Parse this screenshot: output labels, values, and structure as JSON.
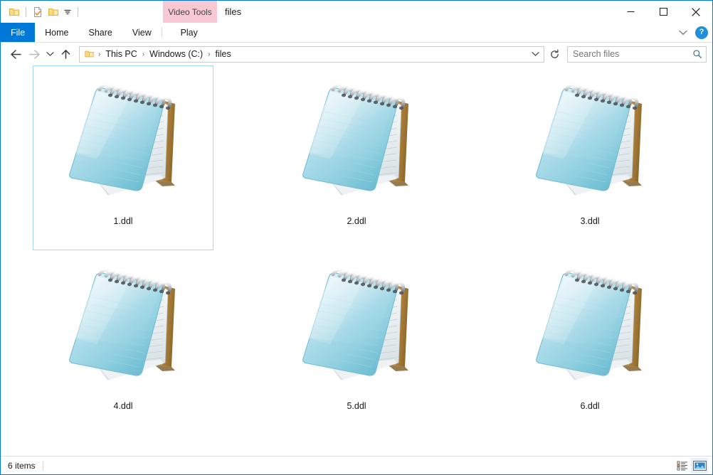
{
  "window": {
    "title": "files",
    "contextual_tab_header": "Video Tools",
    "contextual_color": "#f8c8d4",
    "accent_color": "#0078d7",
    "selection_border_color": "#a6d8f4"
  },
  "quick_access": {
    "items": [
      {
        "name": "system-menu-folder-icon",
        "label": "Folder"
      },
      {
        "name": "properties-icon",
        "label": "Properties"
      },
      {
        "name": "new-folder-icon",
        "label": "New folder"
      },
      {
        "name": "customize-chevron-icon",
        "label": "Customize Quick Access Toolbar"
      }
    ]
  },
  "caption_buttons": {
    "minimize": "—",
    "maximize": "☐",
    "close": "✕"
  },
  "ribbon": {
    "tabs": [
      {
        "label": "File",
        "active_style": "file"
      },
      {
        "label": "Home",
        "active_style": "normal"
      },
      {
        "label": "Share",
        "active_style": "normal"
      },
      {
        "label": "View",
        "active_style": "normal"
      },
      {
        "label": "Play",
        "active_style": "contextual"
      }
    ],
    "collapse_label": "Minimize the Ribbon",
    "help_label": "?"
  },
  "address_bar": {
    "back_label": "Back",
    "forward_label": "Forward",
    "recent_label": "Recent locations",
    "up_label": "Up",
    "refresh_label": "Refresh",
    "breadcrumb": [
      {
        "label": "This PC"
      },
      {
        "label": "Windows (C:)"
      },
      {
        "label": "files"
      }
    ],
    "separator": "›"
  },
  "search": {
    "placeholder": "Search files",
    "value": ""
  },
  "files": {
    "items": [
      {
        "name": "1.ddl",
        "icon": "notepad-icon",
        "selected": true
      },
      {
        "name": "2.ddl",
        "icon": "notepad-icon",
        "selected": false
      },
      {
        "name": "3.ddl",
        "icon": "notepad-icon",
        "selected": false
      },
      {
        "name": "4.ddl",
        "icon": "notepad-icon",
        "selected": false
      },
      {
        "name": "5.ddl",
        "icon": "notepad-icon",
        "selected": false
      },
      {
        "name": "6.ddl",
        "icon": "notepad-icon",
        "selected": false
      }
    ]
  },
  "status_bar": {
    "item_count": "6 items",
    "view_details_label": "Details view",
    "view_large_icons_label": "Large icons view",
    "active_view": "large-icons"
  }
}
